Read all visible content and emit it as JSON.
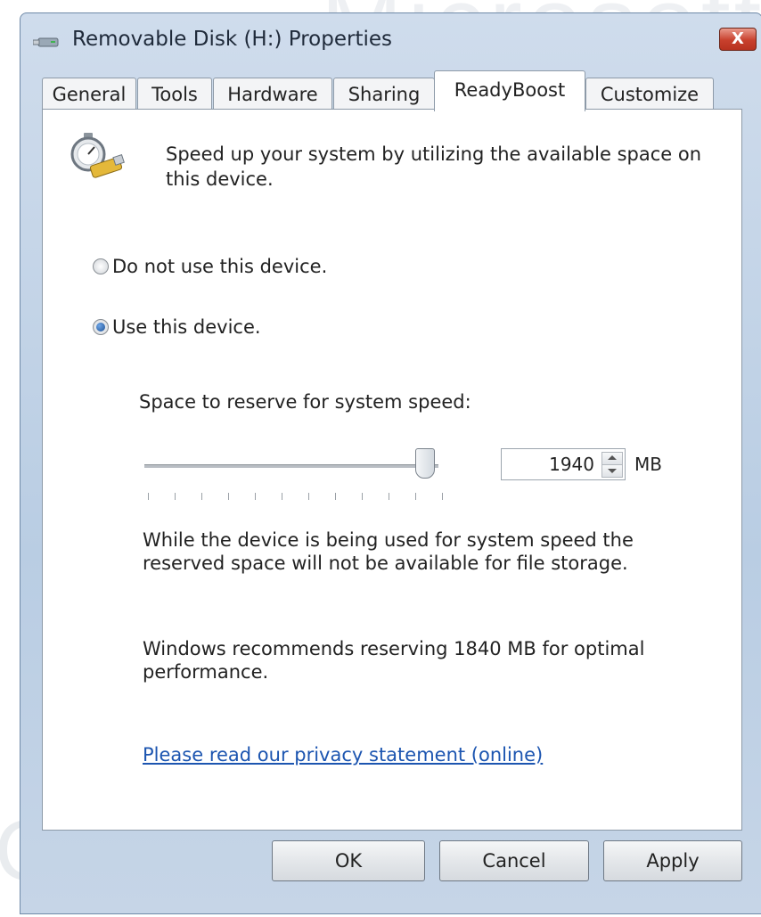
{
  "window": {
    "title": "Removable Disk (H:) Properties",
    "close_label": "X"
  },
  "tabs": [
    {
      "label": "General"
    },
    {
      "label": "Tools"
    },
    {
      "label": "Hardware"
    },
    {
      "label": "Sharing"
    },
    {
      "label": "ReadyBoost"
    },
    {
      "label": "Customize"
    }
  ],
  "active_tab": "ReadyBoost",
  "readyboost": {
    "description": "Speed up your system by utilizing the available space on this device.",
    "option_no_use": "Do not use this device.",
    "option_use": "Use this device.",
    "selected_option": "Use this device.",
    "reserve_label": "Space to reserve for system speed:",
    "reserve_value": "1940",
    "reserve_unit": "MB",
    "slider_level": 0.95,
    "storage_note": "While the device is being used for system speed the reserved space will not be available for file storage.",
    "recommendation": "Windows recommends reserving 1840 MB for optimal performance.",
    "privacy_link": "Please read our privacy statement (online)"
  },
  "buttons": {
    "ok": "OK",
    "cancel": "Cancel",
    "apply": "Apply"
  },
  "colors": {
    "link": "#1c55b0",
    "close_button": "#c8402d"
  }
}
